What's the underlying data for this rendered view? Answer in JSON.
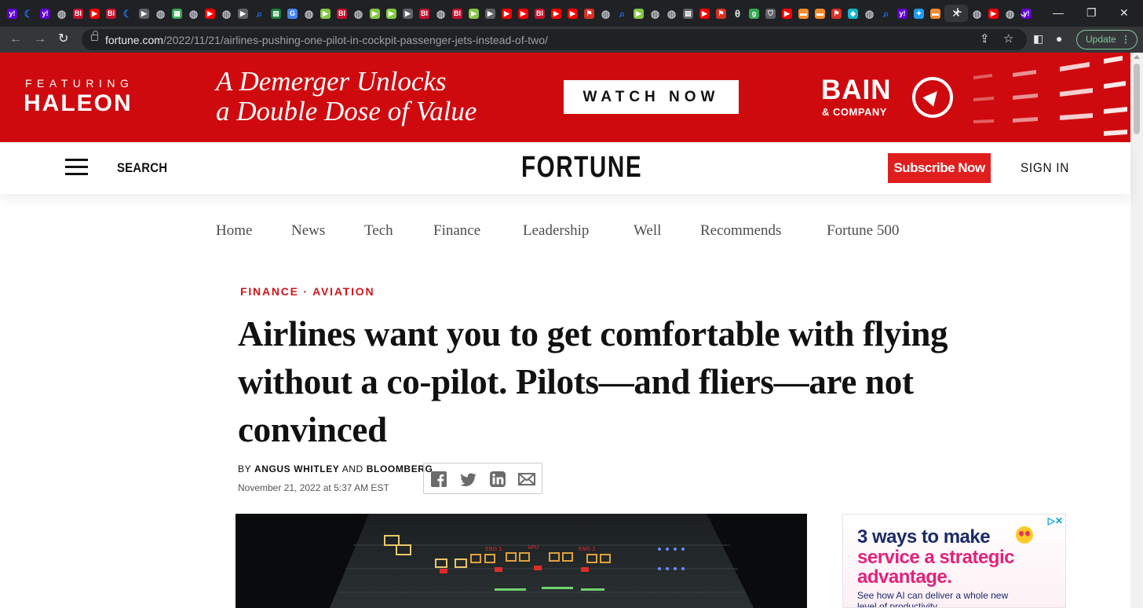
{
  "browser": {
    "tabs": [
      {
        "icon": "yahoo-icon",
        "glyph": "y!",
        "color": "#6001d2"
      },
      {
        "icon": "moon-icon",
        "glyph": "☾",
        "color": "#1a73e8"
      },
      {
        "icon": "yahoo-icon",
        "glyph": "y!",
        "color": "#6001d2"
      },
      {
        "icon": "globe-icon",
        "glyph": "◍",
        "color": "#5f6368"
      },
      {
        "icon": "business-insider-icon",
        "glyph": "BI",
        "color": "#c8102e"
      },
      {
        "icon": "youtube-icon",
        "glyph": "▶",
        "color": "#ff0000"
      },
      {
        "icon": "business-insider-icon",
        "glyph": "BI",
        "color": "#c8102e"
      },
      {
        "icon": "moon-icon",
        "glyph": "☾",
        "color": "#1a73e8"
      },
      {
        "icon": "play-icon",
        "glyph": "▶",
        "color": "#5f6368"
      },
      {
        "icon": "globe-icon",
        "glyph": "◍",
        "color": "#5f6368"
      },
      {
        "icon": "map-icon",
        "glyph": "▦",
        "color": "#34a853"
      },
      {
        "icon": "globe-icon",
        "glyph": "◍",
        "color": "#5f6368"
      },
      {
        "icon": "youtube-icon",
        "glyph": "▶",
        "color": "#ff0000"
      },
      {
        "icon": "globe-icon",
        "glyph": "◍",
        "color": "#5f6368"
      },
      {
        "icon": "play-icon",
        "glyph": "▶",
        "color": "#5f6368"
      },
      {
        "icon": "search-icon",
        "glyph": "⌕",
        "color": "#1a73e8"
      },
      {
        "icon": "document-icon",
        "glyph": "▤",
        "color": "#188038"
      },
      {
        "icon": "google-icon",
        "glyph": "G",
        "color": "#4285f4"
      },
      {
        "icon": "globe-icon",
        "glyph": "◍",
        "color": "#5f6368"
      },
      {
        "icon": "rumble-icon",
        "glyph": "▶",
        "color": "#85c742"
      },
      {
        "icon": "business-insider-icon",
        "glyph": "BI",
        "color": "#c8102e"
      },
      {
        "icon": "globe-icon",
        "glyph": "◍",
        "color": "#5f6368"
      },
      {
        "icon": "rumble-icon",
        "glyph": "▶",
        "color": "#85c742"
      },
      {
        "icon": "rumble-icon",
        "glyph": "▶",
        "color": "#85c742"
      },
      {
        "icon": "play-icon",
        "glyph": "▶",
        "color": "#5f6368"
      },
      {
        "icon": "business-insider-icon",
        "glyph": "BI",
        "color": "#c8102e"
      },
      {
        "icon": "globe-icon",
        "glyph": "◍",
        "color": "#5f6368"
      },
      {
        "icon": "business-insider-icon",
        "glyph": "BI",
        "color": "#c8102e"
      },
      {
        "icon": "rumble-icon",
        "glyph": "▶",
        "color": "#85c742"
      },
      {
        "icon": "play-icon",
        "glyph": "▶",
        "color": "#5f6368"
      },
      {
        "icon": "youtube-icon",
        "glyph": "▶",
        "color": "#ff0000"
      },
      {
        "icon": "youtube-icon",
        "glyph": "▶",
        "color": "#ff0000"
      },
      {
        "icon": "business-insider-icon",
        "glyph": "BI",
        "color": "#c8102e"
      },
      {
        "icon": "youtube-icon",
        "glyph": "▶",
        "color": "#ff0000"
      },
      {
        "icon": "youtube-icon",
        "glyph": "▶",
        "color": "#ff0000"
      },
      {
        "icon": "flag-icon",
        "glyph": "⚑",
        "color": "#d93025"
      },
      {
        "icon": "globe-icon",
        "glyph": "◍",
        "color": "#5f6368"
      },
      {
        "icon": "search-icon",
        "glyph": "⌕",
        "color": "#1a73e8"
      },
      {
        "icon": "rumble-icon",
        "glyph": "▶",
        "color": "#85c742"
      },
      {
        "icon": "globe-icon",
        "glyph": "◍",
        "color": "#5f6368"
      },
      {
        "icon": "globe-icon",
        "glyph": "◍",
        "color": "#5f6368"
      },
      {
        "icon": "news-icon",
        "glyph": "▤",
        "color": "#5f6368"
      },
      {
        "icon": "youtube-icon",
        "glyph": "▶",
        "color": "#ff0000"
      },
      {
        "icon": "flag-icon",
        "glyph": "⚑",
        "color": "#d93025"
      },
      {
        "icon": "theta-icon",
        "glyph": "θ",
        "color": "#202124"
      },
      {
        "icon": "goodreads-icon",
        "glyph": "g",
        "color": "#34a853"
      },
      {
        "icon": "shield-icon",
        "glyph": "⛉",
        "color": "#5f6368"
      },
      {
        "icon": "youtube-icon",
        "glyph": "▶",
        "color": "#ff0000"
      },
      {
        "icon": "bookmark-icon",
        "glyph": "▬",
        "color": "#f28b30"
      },
      {
        "icon": "bookmark-icon",
        "glyph": "▬",
        "color": "#f28b30"
      },
      {
        "icon": "flag-icon",
        "glyph": "⚑",
        "color": "#d93025"
      },
      {
        "icon": "fish-icon",
        "glyph": "◆",
        "color": "#12b5cb"
      },
      {
        "icon": "globe-icon",
        "glyph": "◍",
        "color": "#5f6368"
      },
      {
        "icon": "search-icon",
        "glyph": "⌕",
        "color": "#1a73e8"
      },
      {
        "icon": "yahoo-icon",
        "glyph": "y!",
        "color": "#6001d2"
      },
      {
        "icon": "twitter-icon",
        "glyph": "✦",
        "color": "#1d9bf0"
      },
      {
        "icon": "bookmark-icon",
        "glyph": "▬",
        "color": "#f28b30"
      },
      {
        "icon": "close-tab-icon",
        "glyph": "✕",
        "color": "#e8eaed",
        "active": true
      },
      {
        "icon": "globe-icon",
        "glyph": "◍",
        "color": "#5f6368"
      },
      {
        "icon": "youtube-icon",
        "glyph": "▶",
        "color": "#ff0000"
      },
      {
        "icon": "globe-icon",
        "glyph": "◍",
        "color": "#5f6368"
      },
      {
        "icon": "yahoo-icon",
        "glyph": "y!",
        "color": "#6001d2"
      }
    ],
    "url_host": "fortune.com",
    "url_path": "/2022/11/21/airlines-pushing-one-pilot-in-cockpit-passenger-jets-instead-of-two/",
    "update_label": "Update"
  },
  "ad_banner": {
    "featuring": "FEATURING",
    "brand": "HALEON",
    "headline_line1": "A Demerger Unlocks",
    "headline_line2": "a Double Dose of Value",
    "cta": "WATCH NOW",
    "sponsor": "BAIN",
    "sponsor_sub": "& COMPANY",
    "color": "#cf0a0f"
  },
  "header": {
    "search_label": "SEARCH",
    "logo": "FORTUNE",
    "subscribe_label": "Subscribe Now",
    "signin_label": "SIGN IN",
    "subscribe_color": "#e01e1e"
  },
  "nav": {
    "items": [
      {
        "label": "Home"
      },
      {
        "label": "News"
      },
      {
        "label": "Tech"
      },
      {
        "label": "Finance"
      },
      {
        "label": "Leadership"
      },
      {
        "label": "Well"
      },
      {
        "label": "Recommends"
      },
      {
        "label": "Fortune 500"
      }
    ]
  },
  "article": {
    "category": "FINANCE · AVIATION",
    "headline": "Airlines want you to get comfortable with flying without a co-pilot. Pilots—and fliers—are not convinced",
    "by": "BY",
    "author1": "ANGUS WHITLEY",
    "and": "AND",
    "author2": "BLOOMBERG",
    "date": "November 21, 2022 at 5:37 AM EST",
    "accent_color": "#d1151b"
  },
  "hero_image": {
    "labels": [
      "ENG 1",
      "APU",
      "ENG 2"
    ]
  },
  "side_ad": {
    "line1": "3 ways to make",
    "line2": "service a strategic advantage.",
    "line3": "See how AI can deliver a whole new level of productivity"
  }
}
